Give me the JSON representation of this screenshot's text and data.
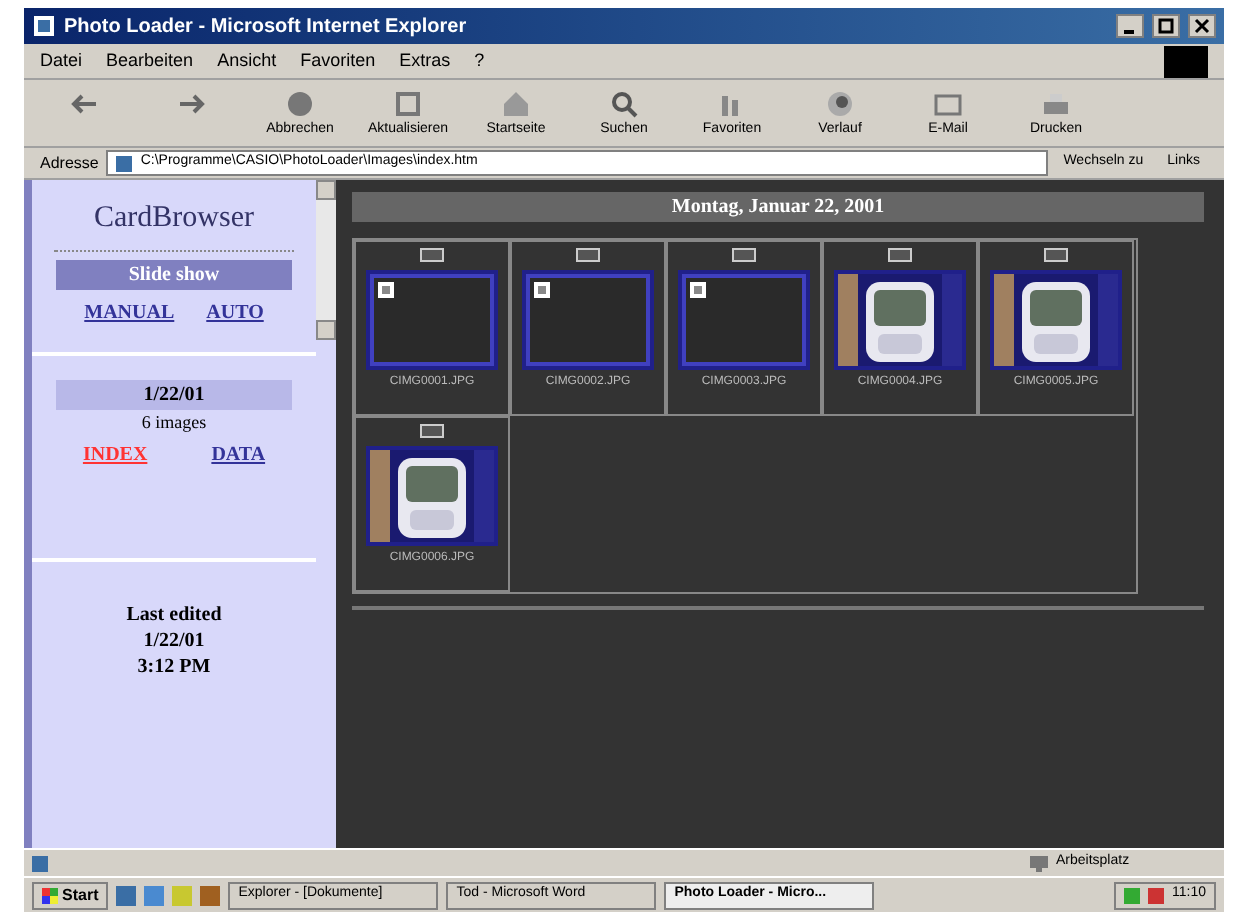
{
  "window": {
    "title": "Photo Loader - Microsoft Internet Explorer"
  },
  "menu": [
    "Datei",
    "Bearbeiten",
    "Ansicht",
    "Favoriten",
    "Extras",
    "?"
  ],
  "toolbar": [
    {
      "kind": "back"
    },
    {
      "kind": "forward"
    },
    {
      "label": "Abbrechen",
      "kind": "stop"
    },
    {
      "label": "Aktualisieren",
      "kind": "refresh"
    },
    {
      "label": "Startseite",
      "kind": "home"
    },
    {
      "label": "Suchen",
      "kind": "search"
    },
    {
      "label": "Favoriten",
      "kind": "favorites"
    },
    {
      "label": "Verlauf",
      "kind": "history"
    },
    {
      "label": "E-Mail",
      "kind": "mail"
    },
    {
      "label": "Drucken",
      "kind": "print"
    }
  ],
  "address": {
    "label": "Adresse",
    "value": "C:\\Programme\\CASIO\\PhotoLoader\\Images\\index.htm",
    "go": "Wechseln zu",
    "links": "Links"
  },
  "sidebar": {
    "title": "CardBrowser",
    "slideshow": "Slide show",
    "modes": [
      "MANUAL",
      "AUTO"
    ],
    "date": "1/22/01",
    "count": "6 images",
    "views": [
      {
        "label": "INDEX",
        "selected": true
      },
      {
        "label": "DATA",
        "selected": false
      }
    ],
    "last_edited": [
      "Last edited",
      "1/22/01",
      "3:12 PM"
    ]
  },
  "main": {
    "heading": "Montag, Januar 22, 2001",
    "thumbnails": [
      {
        "kind": "placeholder",
        "caption": "CIMG0001.JPG"
      },
      {
        "kind": "placeholder",
        "caption": "CIMG0002.JPG"
      },
      {
        "kind": "placeholder",
        "caption": "CIMG0003.JPG"
      },
      {
        "kind": "picture",
        "caption": "CIMG0004.JPG"
      },
      {
        "kind": "picture",
        "caption": "CIMG0005.JPG"
      },
      {
        "kind": "picture",
        "caption": "CIMG0006.JPG"
      }
    ]
  },
  "status_bar": {
    "zone": "Arbeitsplatz"
  },
  "taskbar": {
    "start": "Start",
    "tasks": [
      {
        "label": "Explorer - [Dokumente]",
        "selected": false
      },
      {
        "label": "Tod - Microsoft Word",
        "selected": false
      },
      {
        "label": "Photo Loader - Micro...",
        "selected": true
      }
    ],
    "clock": "11:10"
  }
}
